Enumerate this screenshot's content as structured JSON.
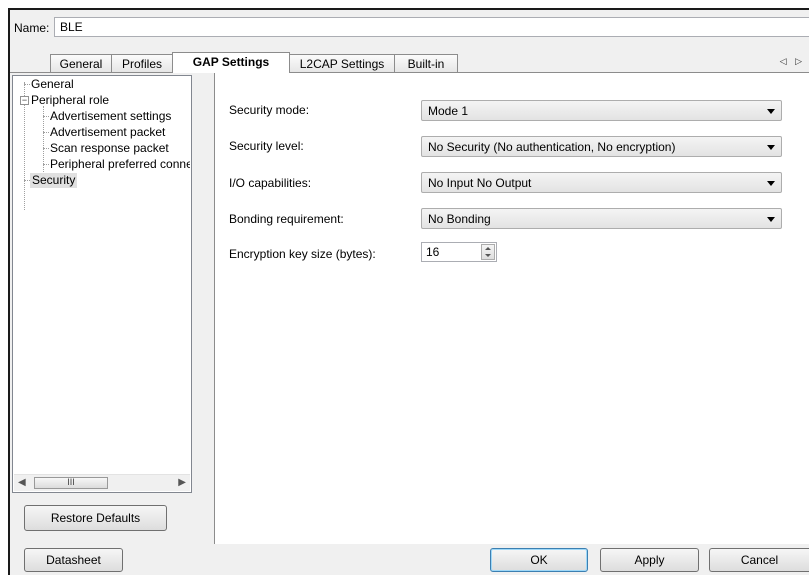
{
  "name_field": {
    "label": "Name:",
    "value": "BLE"
  },
  "tabs": [
    {
      "label": "General",
      "active": false
    },
    {
      "label": "Profiles",
      "active": false
    },
    {
      "label": "GAP Settings",
      "active": true
    },
    {
      "label": "L2CAP Settings",
      "active": false
    },
    {
      "label": "Built-in",
      "active": false
    }
  ],
  "tab_scroll_glyphs": "◁ ▷",
  "tree": {
    "items": [
      {
        "label": "General",
        "level": 0
      },
      {
        "label": "Peripheral role",
        "level": 0,
        "expanded": true
      },
      {
        "label": "Advertisement settings",
        "level": 1
      },
      {
        "label": "Advertisement packet",
        "level": 1
      },
      {
        "label": "Scan response packet",
        "level": 1
      },
      {
        "label": "Peripheral preferred connection parameters",
        "level": 1
      },
      {
        "label": "Security",
        "level": 0,
        "selected": true
      }
    ],
    "expander_glyph": "−",
    "scroll_left": "◀",
    "scroll_right": "▶",
    "scroll_thumb_grip": "III"
  },
  "restore_defaults_label": "Restore Defaults",
  "settings": {
    "security_mode": {
      "label": "Security mode:",
      "value": "Mode 1"
    },
    "security_level": {
      "label": "Security level:",
      "value": "No Security (No authentication, No encryption)"
    },
    "io_capabilities": {
      "label": "I/O capabilities:",
      "value": "No Input No Output"
    },
    "bonding_requirement": {
      "label": "Bonding requirement:",
      "value": "No Bonding"
    },
    "encryption_key_size": {
      "label": "Encryption key size (bytes):",
      "value": "16"
    }
  },
  "footer": {
    "datasheet_label": "Datasheet",
    "ok_label": "OK",
    "apply_label": "Apply",
    "cancel_label": "Cancel"
  },
  "colors": {
    "window_bg": "#f0f0f0",
    "panel_bg": "#ffffff",
    "default_button_border": "#3c7fb1"
  }
}
